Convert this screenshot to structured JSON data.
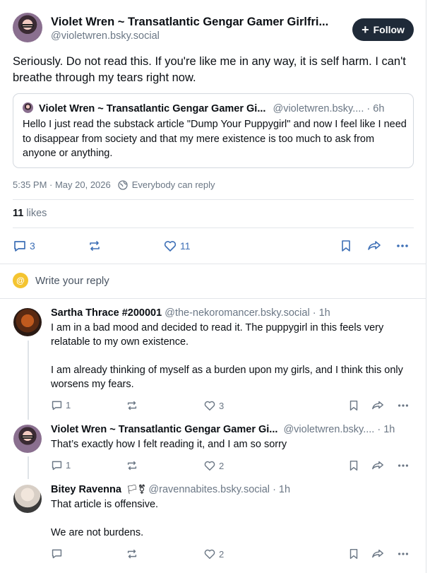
{
  "main_post": {
    "author_name": "Violet Wren ~ Transatlantic Gengar Gamer Girlfri...",
    "author_handle": "@violetwren.bsky.social",
    "follow_label": "Follow",
    "text": "Seriously. Do not read this. If you're like me in any way, it is self harm. I can't breathe through my tears right now.",
    "quote": {
      "author_name": "Violet Wren ~ Transatlantic Gengar Gamer Gi...",
      "author_handle": "@violetwren.bsky....",
      "time": "6h",
      "text": "Hello I just read the substack article \"Dump Your Puppygirl\" and now I feel like I need to disappear from society and that my mere existence is too much to ask from anyone or anything."
    },
    "timestamp": "5:35 PM · May 20, 2026",
    "reply_setting": "Everybody can reply",
    "likes_count": "11",
    "likes_label": "likes",
    "actions": {
      "replies": "3",
      "likes": "11"
    }
  },
  "reply_box": {
    "placeholder": "Write your reply"
  },
  "replies": [
    {
      "author_name": "Sartha Thrace #200001",
      "author_handle": "@the-nekoromancer.bsky.social",
      "time": "· 1h",
      "paragraphs": [
        "I am in a bad mood and decided to read it. The puppygirl in this feels very relatable to my own existence.",
        "I am already thinking of myself as a burden upon my girls, and I think this only worsens my fears."
      ],
      "reply_count": "1",
      "like_count": "3"
    },
    {
      "author_name": "Violet Wren ~ Transatlantic Gengar Gamer Gi...",
      "author_handle": "@violetwren.bsky....",
      "time": "· 1h",
      "paragraphs": [
        "That’s exactly how I felt reading it, and I am so sorry"
      ],
      "reply_count": "1",
      "like_count": "2"
    },
    {
      "author_name": "Bitey Ravenna",
      "author_flags": "🏳⚧",
      "author_handle": "@ravennabites.bsky.social",
      "time": "· 1h",
      "paragraphs": [
        "That article is offensive.",
        "We are not burdens."
      ],
      "reply_count": "",
      "like_count": "2"
    }
  ],
  "colors": {
    "follow_bg": "#1f2a38",
    "muted": "#6b7785",
    "accent_yellow": "#f4c430"
  }
}
